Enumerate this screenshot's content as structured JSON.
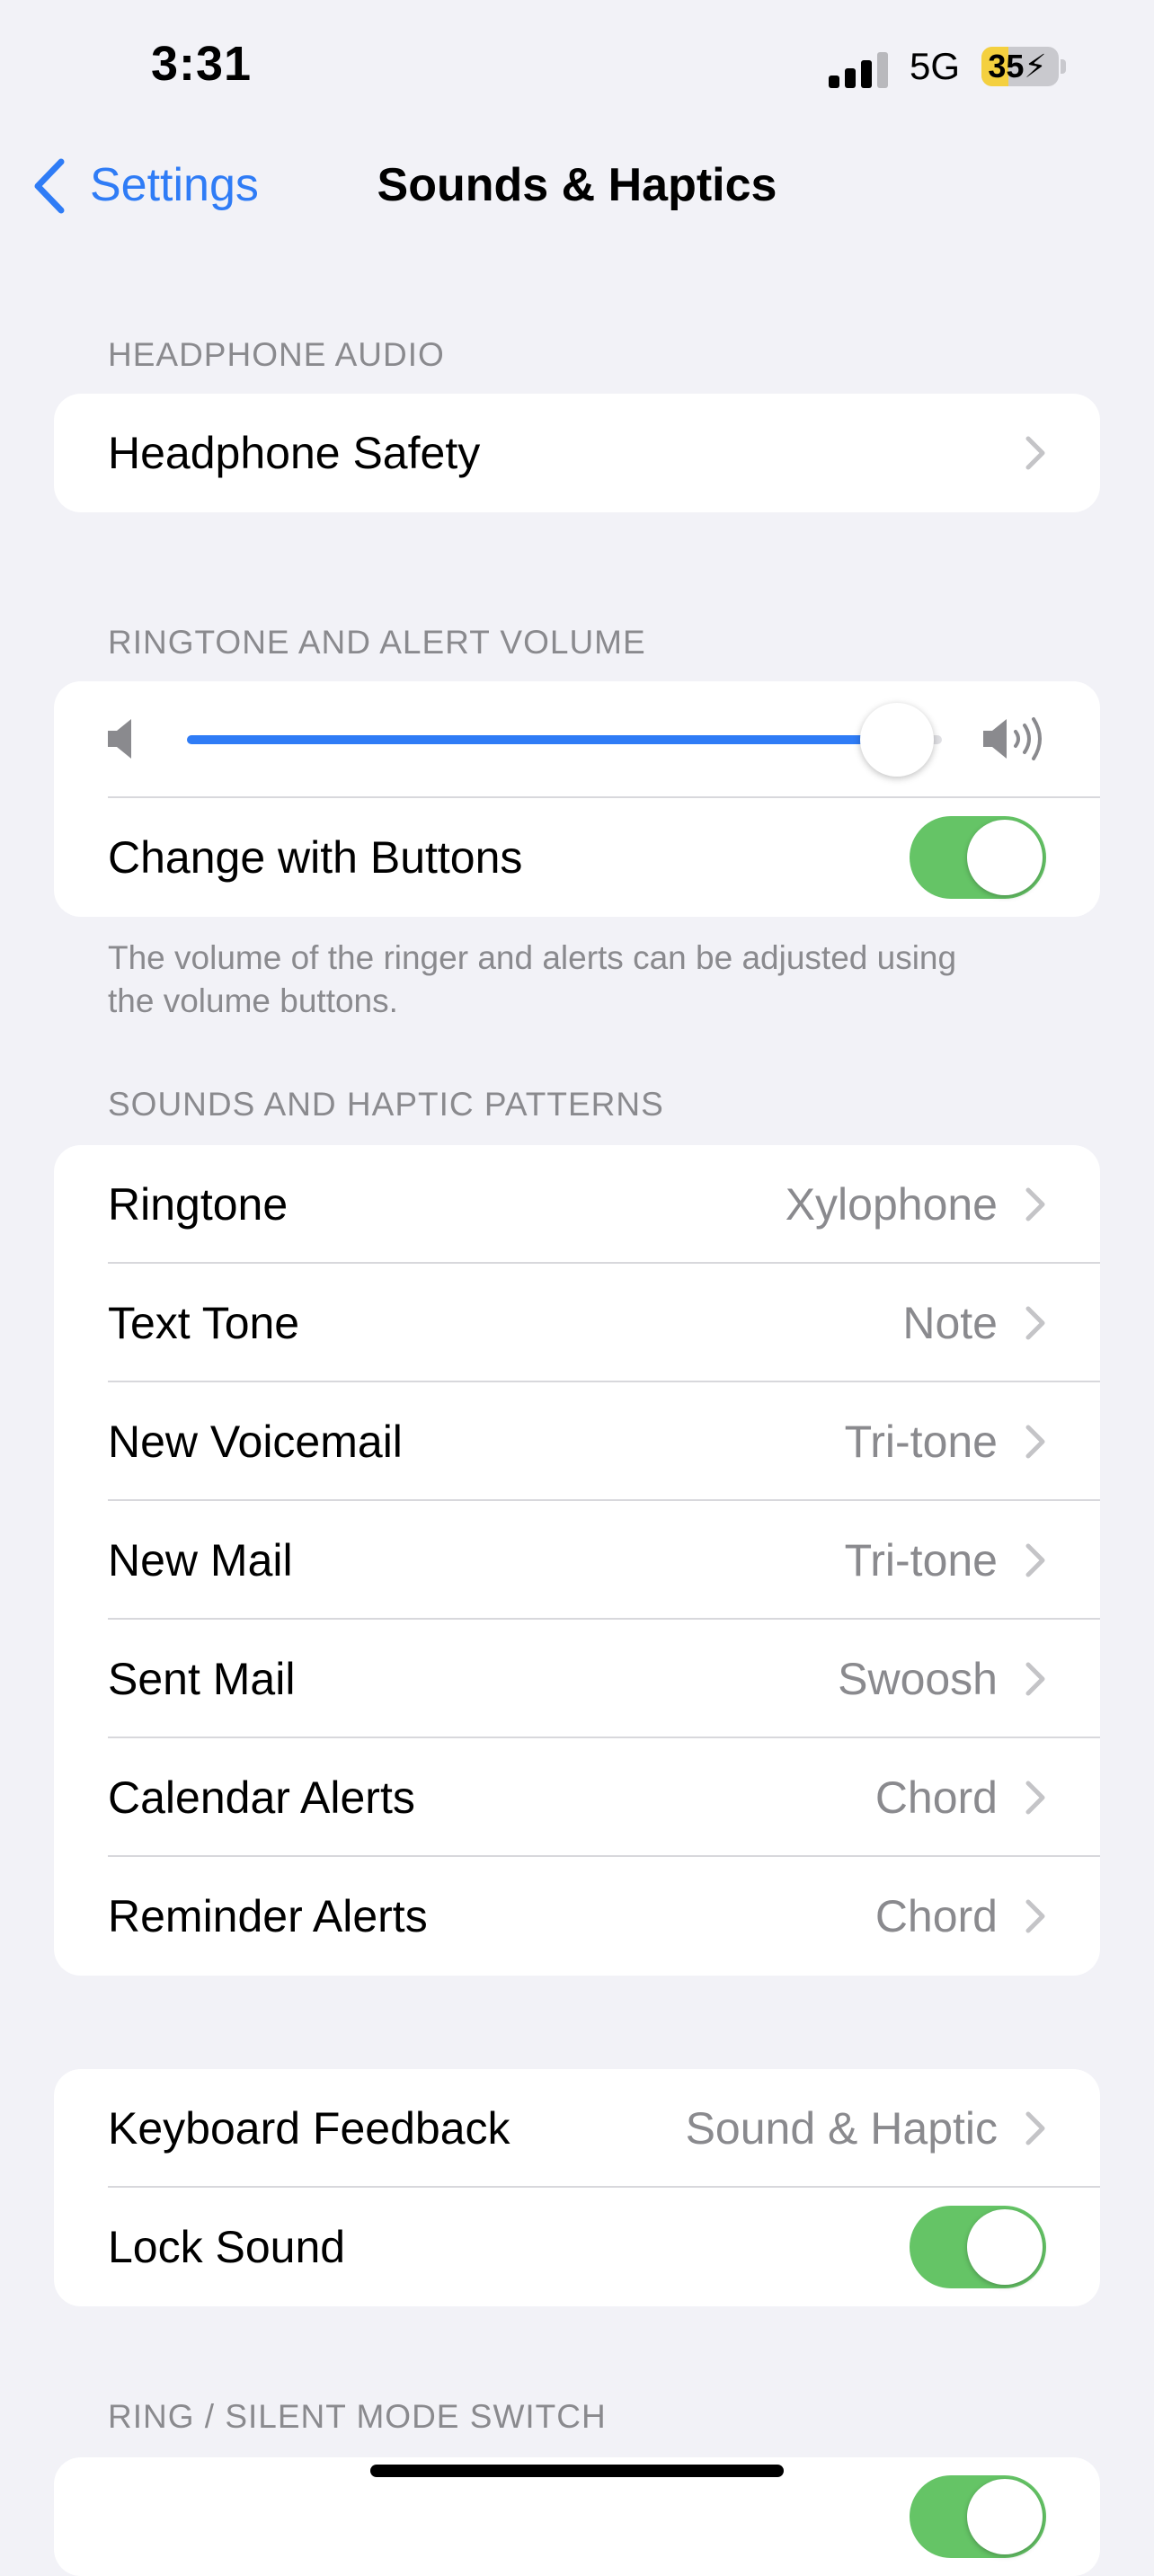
{
  "status_bar": {
    "time": "3:31",
    "network": "5G",
    "battery_text": "35",
    "battery_level": 0.35
  },
  "nav": {
    "back_label": "Settings",
    "title": "Sounds & Haptics"
  },
  "headphone_audio": {
    "header": "HEADPHONE AUDIO",
    "items": [
      {
        "label": "Headphone Safety"
      }
    ]
  },
  "ringtone_volume": {
    "header": "RINGTONE AND ALERT VOLUME",
    "volume_level": 0.94,
    "change_with_buttons": {
      "label": "Change with Buttons",
      "on": true
    },
    "footer": "The volume of the ringer and alerts can be adjusted using the volume buttons."
  },
  "patterns": {
    "header": "SOUNDS AND HAPTIC PATTERNS",
    "items": [
      {
        "label": "Ringtone",
        "value": "Xylophone"
      },
      {
        "label": "Text Tone",
        "value": "Note"
      },
      {
        "label": "New Voicemail",
        "value": "Tri-tone"
      },
      {
        "label": "New Mail",
        "value": "Tri-tone"
      },
      {
        "label": "Sent Mail",
        "value": "Swoosh"
      },
      {
        "label": "Calendar Alerts",
        "value": "Chord"
      },
      {
        "label": "Reminder Alerts",
        "value": "Chord"
      }
    ]
  },
  "feedback": {
    "keyboard": {
      "label": "Keyboard Feedback",
      "value": "Sound & Haptic"
    },
    "lock_sound": {
      "label": "Lock Sound",
      "on": true
    }
  },
  "ring_silent": {
    "header": "RING / SILENT MODE SWITCH",
    "toggle_on": true
  },
  "colors": {
    "accent": "#2f7cf6",
    "toggle_on": "#65c466",
    "background": "#f2f2f7",
    "battery": "#f4d03f"
  }
}
